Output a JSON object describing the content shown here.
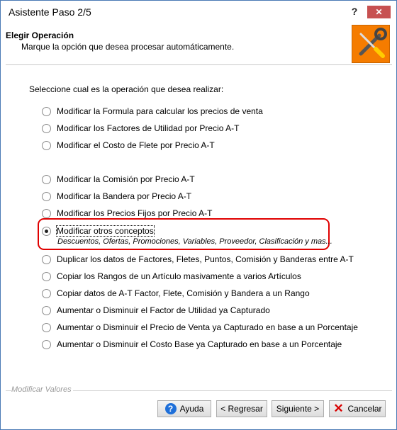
{
  "window": {
    "title": "Asistente Paso 2/5",
    "help_glyph": "?",
    "close_glyph": "✕"
  },
  "header": {
    "title": "Elegir Operación",
    "subtitle": "Marque la opción que desea procesar automáticamente.",
    "icon": "tools-icon",
    "icon_bg": "#f57c00"
  },
  "main": {
    "prompt": "Seleccione cual es la operación que desea realizar:",
    "options": [
      {
        "label": "Modificar la Formula para calcular los precios de venta",
        "checked": false
      },
      {
        "label": "Modificar los Factores de Utilidad por Precio A-T",
        "checked": false
      },
      {
        "label": "Modificar el Costo de Flete por Precio A-T",
        "checked": false
      },
      {
        "label": "Modificar la Comisión por Precio A-T",
        "checked": false
      },
      {
        "label": "Modificar la Bandera por Precio A-T",
        "checked": false
      },
      {
        "label": "Modificar los Precios Fijos por Precio A-T",
        "checked": false
      },
      {
        "label": "Modificar otros conceptos",
        "checked": true,
        "sublabel": "Descuentos, Ofertas, Promociones, Variables, Proveedor, Clasificación y mas..."
      },
      {
        "label": "Duplicar los datos de Factores, Fletes, Puntos, Comisión y Banderas entre A-T",
        "checked": false
      },
      {
        "label": "Copiar los Rangos de un Artículo masivamente a varios Artículos",
        "checked": false
      },
      {
        "label": "Copiar datos de A-T Factor, Flete, Comisión y Bandera a un Rango",
        "checked": false
      },
      {
        "label": "Aumentar o Disminuir el Factor de Utilidad ya Capturado",
        "checked": false
      },
      {
        "label": "Aumentar o Disminuir el Precio de Venta ya Capturado en base a un Porcentaje",
        "checked": false
      },
      {
        "label": "Aumentar o Disminuir el Costo Base ya Capturado en base a un Porcentaje",
        "checked": false
      }
    ],
    "highlight_color": "#e00000"
  },
  "footer": {
    "group_label": "Modificar Valores",
    "buttons": {
      "help": {
        "label": "Ayuda",
        "icon": "help-icon"
      },
      "back": {
        "label": "< Regresar"
      },
      "next": {
        "label": "Siguiente >"
      },
      "cancel": {
        "label": "Cancelar",
        "icon": "x-icon"
      }
    }
  }
}
